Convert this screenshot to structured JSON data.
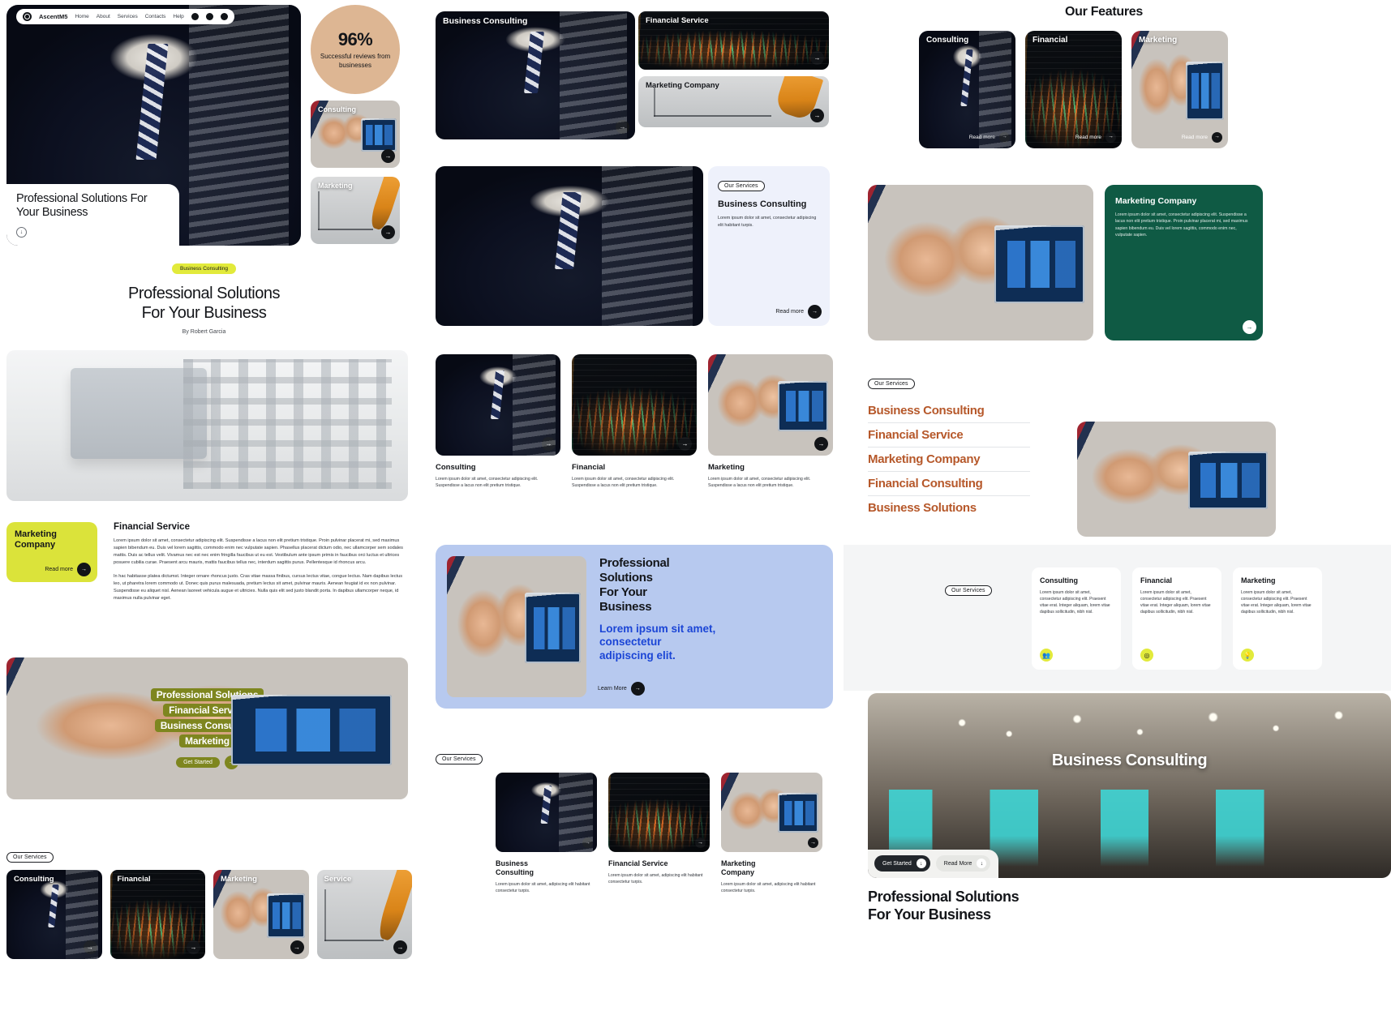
{
  "brand": {
    "name": "AscentM5",
    "nav": [
      "Home",
      "About",
      "Services",
      "Contacts",
      "Help"
    ],
    "social": [
      "instagram-icon",
      "twitter-icon",
      "behance-icon"
    ]
  },
  "colors": {
    "accent_yellow": "#dbe33a",
    "accent_tan": "#ddb693",
    "accent_green": "#0f5a44",
    "accent_blue": "#b7c9ef",
    "accent_orange": "#b6582a",
    "link_blue": "#1b45d6",
    "olive": "#7e861f"
  },
  "col1": {
    "hero": {
      "title": "Professional Solutions\nFor Your Business",
      "scroll_icon": "arrow-down-icon"
    },
    "stat": {
      "number": "96%",
      "label": "Successful reviews\nfrom businesses"
    },
    "mini_cards": [
      {
        "title": "Consulting",
        "image": "meeting-photo"
      },
      {
        "title": "Marketing",
        "image": "wireframe-photo"
      }
    ],
    "article": {
      "tag": "Business Consulting",
      "title": "Professional Solutions\nFor Your Business",
      "byline": "By Robert Garcia"
    },
    "financial": {
      "card_title": "Marketing\nCompany",
      "card_cta": "Read more",
      "heading": "Financial Service",
      "para1": "Lorem ipsum dolor sit amet, consectetur adipiscing elit. Suspendisse a lacus non elit pretium tristique. Proin pulvinar placerat mi, sed maximus sapien bibendum eu. Duis vel lorem sagittis, commodo enim nec vulputate sapien. Phasellus placerat dictum odio, nec ullamcorper sem sodales mattis. Duis ac tellus velit. Vivamus nec est nec enim fringilla faucibus ut eu est. Vestibulum ante ipsum primis in faucibus orci luctus et ultrices posuere cubilia curae. Praesent arcu mauris, mattis faucibus tellus nec, interdum sagittis purus. Pellentesque id rhoncus arcu.",
      "para2": "In hac habitasse platea dictumst. Integer ornare rhoncus justo. Cras vitae massa finibus, cursus lectus vitae, congue lectus. Nam dapibus lectus leo, ut pharetra lorem commodo ut. Donec quis purus malesuada, pretium lectus sit amet, pulvinar mauris. Aenean feugiat id ex non pulvinar. Suspendisse eu aliquet nisl. Aenean laoreet vehicula augue et ultricies. Nulla quis elit sed justo blandit porta. In dapibus ullamcorper neque, id maximus nulla pulvinar eget."
    },
    "cta": {
      "lines": [
        "Professional Solutions",
        "Financial Service",
        "Business Consulting",
        "Marketing"
      ],
      "button": "Get Started"
    },
    "services_strip": {
      "tag": "Our Services",
      "cards": [
        {
          "title": "Consulting",
          "image": "suit-photo"
        },
        {
          "title": "Financial",
          "image": "chart-photo"
        },
        {
          "title": "Marketing",
          "image": "meeting-photo"
        },
        {
          "title": "Service",
          "image": "wireframe-photo"
        }
      ]
    }
  },
  "col2": {
    "top_cards": [
      {
        "title": "Business Consulting",
        "image": "suit-photo"
      },
      {
        "title": "Financial Service",
        "image": "chart-photo"
      },
      {
        "title": "Marketing Company",
        "image": "wireframe-photo"
      }
    ],
    "split": {
      "tag": "Our Services",
      "title": "Business Consulting",
      "body": "Lorem ipsum dolor sit amet, consectetur adipiscing elit habitant turpis.",
      "cta": "Read more"
    },
    "three_cards": [
      {
        "title": "Consulting",
        "body": "Lorem ipsum dolor sit amet, consectetur adipiscing elit. Suspendisse a lacus non elit pretium tristique.",
        "image": "suit-photo"
      },
      {
        "title": "Financial",
        "body": "Lorem ipsum dolor sit amet, consectetur adipiscing elit. Suspendisse a lacus non elit pretium tristique.",
        "image": "chart-photo"
      },
      {
        "title": "Marketing",
        "body": "Lorem ipsum dolor sit amet, consectetur adipiscing elit. Suspendisse a lacus non elit pretium tristique.",
        "image": "meeting-photo"
      }
    ],
    "banner": {
      "title": "Professional\nSolutions\nFor Your\nBusiness",
      "subtitle": "Lorem ipsum sit amet,\nconsectetur\nadipiscing elit.",
      "cta": "Learn More"
    },
    "bottom": {
      "tag": "Our Services",
      "cards": [
        {
          "title": "Business\nConsulting",
          "body": "Lorem ipsum dolor sit amet, adipiscing elit habitant consectetur turpis.",
          "image": "suit-photo"
        },
        {
          "title": "Financial Service",
          "body": "Lorem ipsum dolor sit amet, adipiscing elit habitant consectetur turpis.",
          "image": "chart-photo"
        },
        {
          "title": "Marketing\nCompany",
          "body": "Lorem ipsum dolor sit amet, adipiscing elit habitant consectetur turpis.",
          "image": "meeting-photo"
        }
      ]
    }
  },
  "col3": {
    "features": {
      "title": "Our Features",
      "cards": [
        {
          "title": "Consulting",
          "cta": "Read more",
          "image": "suit-photo"
        },
        {
          "title": "Financial",
          "cta": "Read more",
          "image": "chart-photo"
        },
        {
          "title": "Marketing",
          "cta": "Read more",
          "image": "meeting-photo"
        }
      ]
    },
    "green_block": {
      "image": "meeting-photo",
      "title": "Marketing Company",
      "body": "Lorem ipsum dolor sit amet, consectetur adipiscing elit. Suspendisse a lacus non elit pretium tristique. Proin pulvinar placerat mi, sed maximus sapien bibendum eu. Duis vel lorem sagittis, commodo enim nec, vulputate sapien."
    },
    "list_section": {
      "tag": "Our Services",
      "items": [
        "Business Consulting",
        "Financial Service",
        "Marketing Company",
        "Financial Consulting",
        "Business Solutions"
      ],
      "image": "meeting-photo"
    },
    "grey_panel": {
      "tag": "Our Services",
      "cards": [
        {
          "title": "Consulting",
          "body": "Lorem ipsum dolor sit amet, consectetur adipiscing elit. Praesent vitae erat. Integer aliquam, lorem vitae dapibus sollicitudin, nibh nisl.",
          "icon": "people-icon"
        },
        {
          "title": "Financial",
          "body": "Lorem ipsum dolor sit amet, consectetur adipiscing elit. Praesent vitae erat. Integer aliquam, lorem vitae dapibus sollicitudin, nibh nisl.",
          "icon": "target-icon"
        },
        {
          "title": "Marketing",
          "body": "Lorem ipsum dolor sit amet, consectetur adipiscing elit. Praesent vitae erat. Integer aliquam, lorem vitae dapibus sollicitudin, nibh nisl.",
          "icon": "bulb-icon"
        }
      ]
    },
    "final": {
      "title": "Business Consulting",
      "btn_primary": "Get Started",
      "btn_secondary": "Read More",
      "footer_title": "Professional Solutions\nFor Your Business"
    }
  }
}
